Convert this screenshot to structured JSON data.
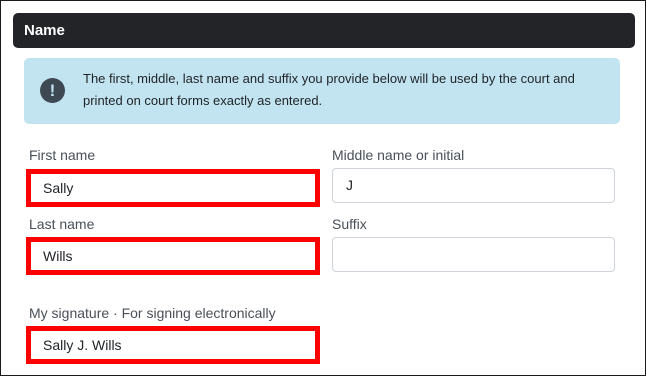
{
  "section": {
    "title": "Name"
  },
  "alert": {
    "icon": "exclamation-circle-icon",
    "icon_glyph": "!",
    "text": "The first, middle, last name and suffix you provide below will be used by the court and printed on court forms exactly as entered."
  },
  "fields": {
    "first_name": {
      "label": "First name",
      "value": "Sally"
    },
    "middle_name": {
      "label": "Middle name or initial",
      "value": "J"
    },
    "last_name": {
      "label": "Last name",
      "value": "Wills"
    },
    "suffix": {
      "label": "Suffix",
      "value": ""
    },
    "signature": {
      "label": "My signature · For signing electronically",
      "value": "Sally J. Wills"
    }
  },
  "colors": {
    "header_bg": "#232427",
    "alert_bg": "#c2e4f1",
    "highlight": "#ff0000"
  }
}
